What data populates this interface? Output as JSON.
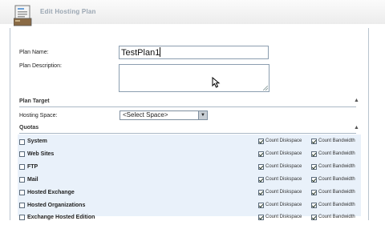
{
  "page": {
    "title": "Edit Hosting Plan"
  },
  "form": {
    "plan_name_label": "Plan Name:",
    "plan_name_value": "TestPlan1",
    "plan_description_label": "Plan Description:",
    "plan_description_value": ""
  },
  "plan_target": {
    "title": "Plan Target",
    "hosting_space_label": "Hosting Space:",
    "hosting_space_value": "<Select Space>"
  },
  "quotas": {
    "title": "Quotas",
    "count_diskspace_label": "Count Diskspace",
    "count_bandwidth_label": "Count Bandwidth",
    "items": [
      {
        "name": "System"
      },
      {
        "name": "Web Sites"
      },
      {
        "name": "FTP"
      },
      {
        "name": "Mail"
      },
      {
        "name": "Hosted Exchange"
      },
      {
        "name": "Hosted Organizations"
      },
      {
        "name": "Exchange Hosted Edition"
      }
    ]
  },
  "icons": {
    "page_icon": "hosting-plan-icon",
    "collapse_icon": "chevron-up-icon",
    "dropdown_icon": "dropdown-arrow-icon",
    "cursor_icon": "mouse-pointer-icon"
  }
}
